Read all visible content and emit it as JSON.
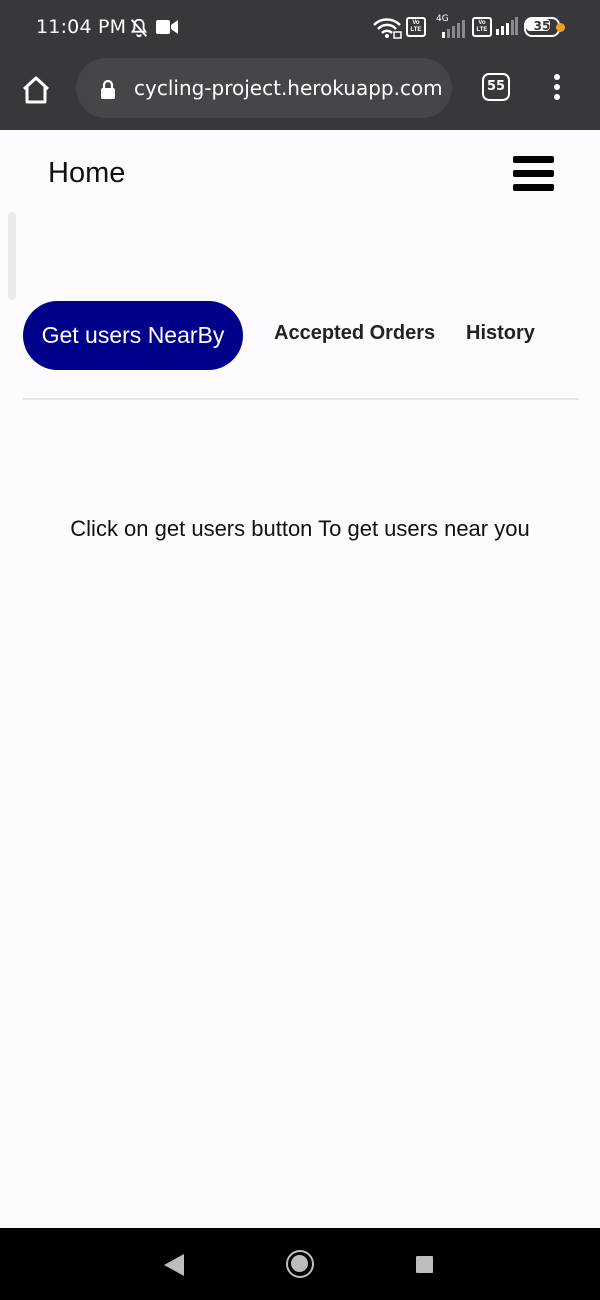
{
  "status_bar": {
    "time": "11:04 PM",
    "volte_label": "Vo LTE",
    "network_label": "4G",
    "battery_level": "35",
    "icons": [
      "bell-off-icon",
      "video-icon",
      "wifi-icon",
      "volte-icon",
      "signal-icon",
      "battery-icon"
    ]
  },
  "browser": {
    "url": "cycling-project.herokuapp.com",
    "tab_count": "55",
    "icons": [
      "home-icon",
      "lock-icon",
      "tabs-icon",
      "menu-dots-icon"
    ]
  },
  "page": {
    "title": "Home",
    "tabs": [
      {
        "label": "Get users NearBy",
        "active": true
      },
      {
        "label": "Accepted Orders",
        "active": false
      },
      {
        "label": "History",
        "active": false
      }
    ],
    "message": "Click on get users button To get users near you"
  },
  "colors": {
    "accent": "#00008b",
    "status_bar": "#38373c",
    "background": "#fdfbfe"
  }
}
